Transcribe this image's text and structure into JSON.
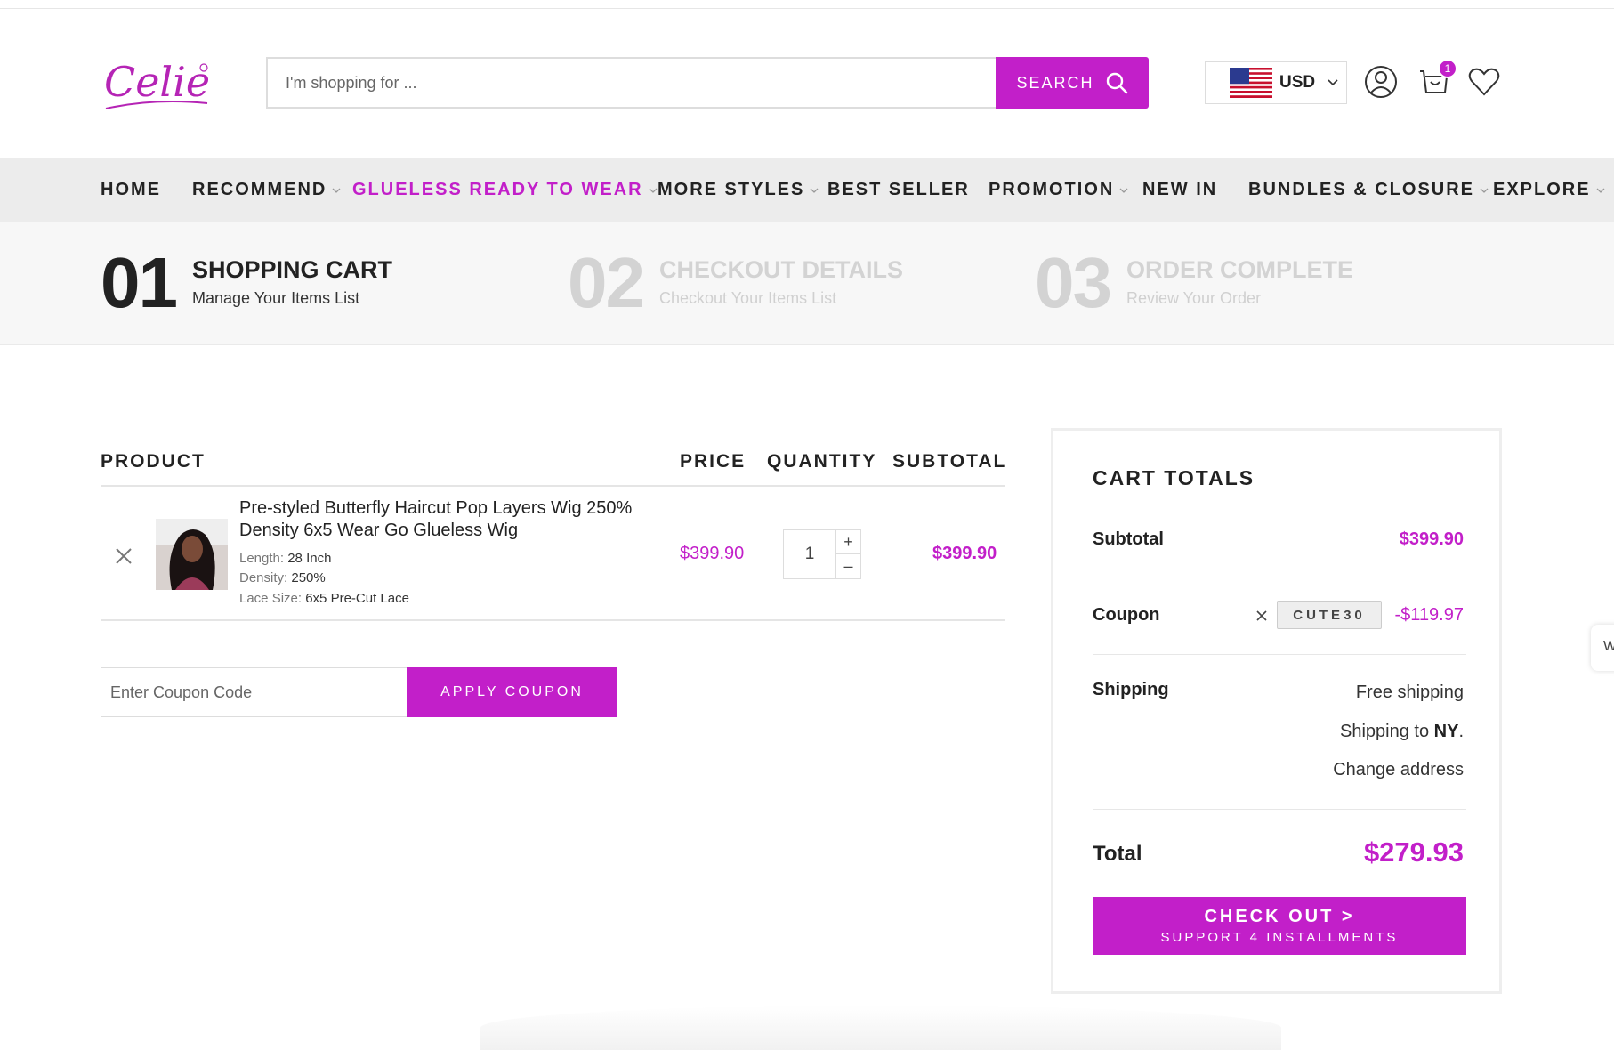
{
  "header": {
    "logo_text": "Celie",
    "search": {
      "placeholder": "I'm shopping for ...",
      "button_label": "SEARCH"
    },
    "currency": {
      "code": "USD",
      "flag": "us-flag-icon"
    },
    "cart_count": "1",
    "icons": [
      "user-icon",
      "cart-icon",
      "heart-icon"
    ]
  },
  "nav": {
    "items": [
      {
        "label": "HOME",
        "dropdown": false,
        "active": false
      },
      {
        "label": "RECOMMEND",
        "dropdown": true,
        "active": false
      },
      {
        "label": "GLUELESS READY TO WEAR",
        "dropdown": true,
        "active": true
      },
      {
        "label": "MORE STYLES",
        "dropdown": true,
        "active": false
      },
      {
        "label": "BEST SELLER",
        "dropdown": false,
        "active": false
      },
      {
        "label": "PROMOTION",
        "dropdown": true,
        "active": false
      },
      {
        "label": "NEW IN",
        "dropdown": false,
        "active": false
      },
      {
        "label": "BUNDLES & CLOSURE",
        "dropdown": true,
        "active": false
      },
      {
        "label": "EXPLORE",
        "dropdown": true,
        "active": false
      }
    ]
  },
  "steps": [
    {
      "num": "01",
      "title": "SHOPPING CART",
      "subtitle": "Manage Your Items List",
      "active": true
    },
    {
      "num": "02",
      "title": "CHECKOUT DETAILS",
      "subtitle": "Checkout Your Items List",
      "active": false
    },
    {
      "num": "03",
      "title": "ORDER COMPLETE",
      "subtitle": "Review Your Order",
      "active": false
    }
  ],
  "cart": {
    "headers": {
      "product": "PRODUCT",
      "price": "PRICE",
      "quantity": "QUANTITY",
      "subtotal": "SUBTOTAL"
    },
    "items": [
      {
        "name": "Pre-styled Butterfly Haircut Pop Layers Wig 250% Density 6x5 Wear Go Glueless Wig",
        "attrs": [
          {
            "label": "Length:",
            "value": "28 Inch"
          },
          {
            "label": "Density:",
            "value": "250%"
          },
          {
            "label": "Lace Size:",
            "value": "6x5 Pre-Cut Lace"
          }
        ],
        "price": "$399.90",
        "quantity": "1",
        "subtotal": "$399.90"
      }
    ],
    "coupon": {
      "placeholder": "Enter Coupon Code",
      "button_label": "APPLY COUPON"
    }
  },
  "totals": {
    "title": "CART TOTALS",
    "subtotal_label": "Subtotal",
    "subtotal_value": "$399.90",
    "coupon_label": "Coupon",
    "coupon_code": "CUTE30",
    "coupon_value": "-$119.97",
    "shipping_label": "Shipping",
    "shipping_method": "Free shipping",
    "shipping_to_prefix": "Shipping to ",
    "shipping_to_state": "NY",
    "shipping_to_suffix": ".",
    "change_address": "Change address",
    "total_label": "Total",
    "total_value": "$279.93",
    "checkout_label": "CHECK OUT >",
    "checkout_sub": "SUPPORT 4 INSTALLMENTS"
  },
  "side_tab": "W",
  "colors": {
    "accent": "#c21fc9",
    "text": "#222222",
    "nav_bg": "#ececec"
  }
}
